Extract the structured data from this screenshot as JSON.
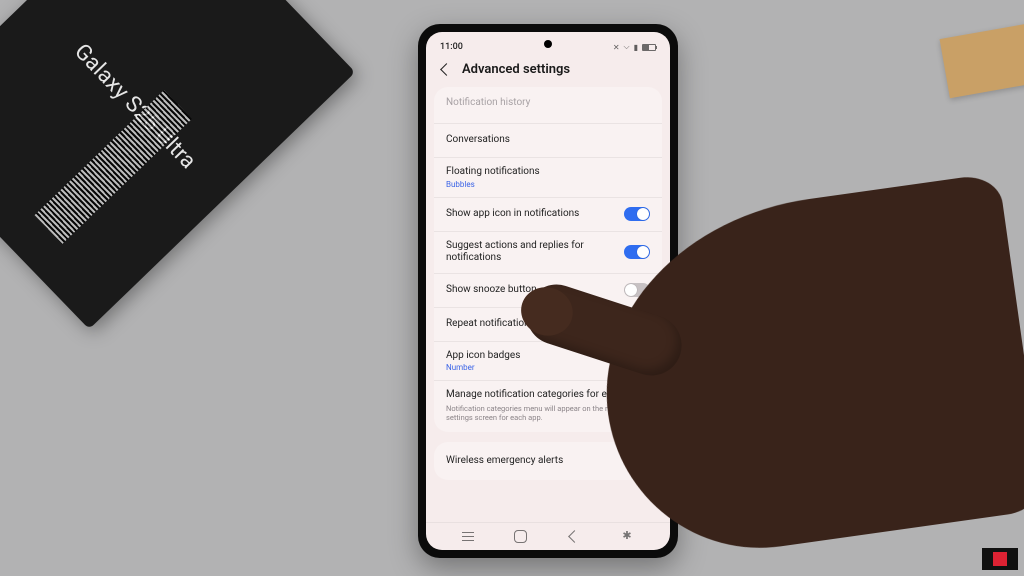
{
  "box": {
    "product_name": "Galaxy S25 Ultra"
  },
  "status": {
    "time": "11:00"
  },
  "header": {
    "title": "Advanced settings"
  },
  "rows": {
    "history": {
      "title": "Notification history"
    },
    "conversations": {
      "title": "Conversations"
    },
    "floating": {
      "title": "Floating notifications",
      "sub": "Bubbles"
    },
    "show_app_icon": {
      "title": "Show app icon in notifications",
      "on": true
    },
    "suggest": {
      "title": "Suggest actions and replies for notifications",
      "on": true
    },
    "snooze": {
      "title": "Show snooze button",
      "on": false
    },
    "repeat": {
      "title": "Repeat notification alerts",
      "on": false
    },
    "badges": {
      "title": "App icon badges",
      "sub": "Number"
    },
    "categories": {
      "title": "Manage notification categories for each app",
      "desc": "Notification categories menu will appear on the notification settings screen for each app."
    },
    "wireless": {
      "title": "Wireless emergency alerts"
    }
  }
}
